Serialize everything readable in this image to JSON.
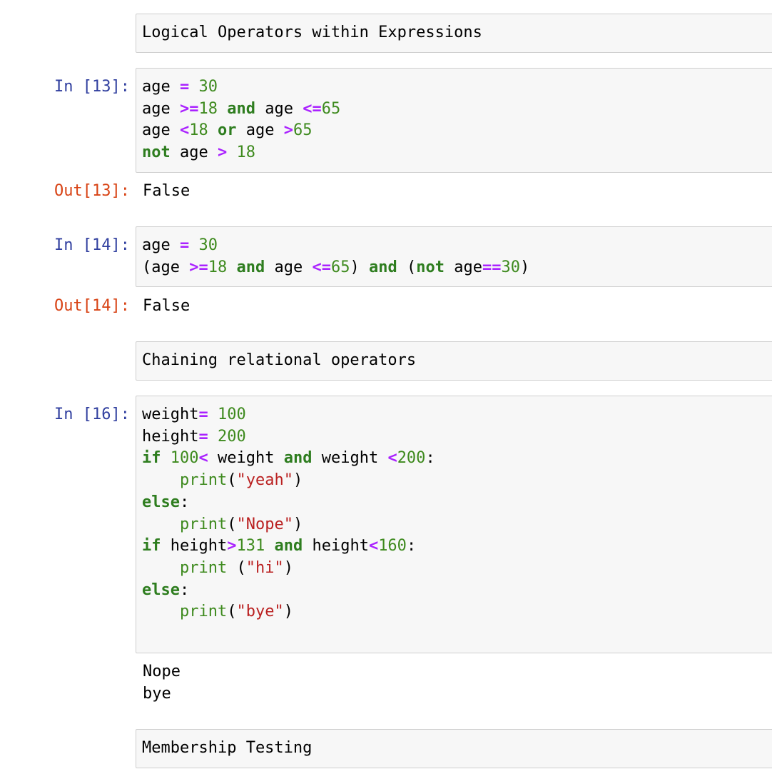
{
  "cells": {
    "md1": {
      "text": "Logical Operators within Expressions"
    },
    "c13": {
      "in_prompt": "In [13]:",
      "out_prompt": "Out[13]:",
      "output": "False",
      "tokens": [
        [
          [
            "t",
            "age "
          ],
          [
            "op",
            "="
          ],
          [
            "t",
            " "
          ],
          [
            "num",
            "30"
          ]
        ],
        [
          [
            "t",
            "age "
          ],
          [
            "op",
            ">="
          ],
          [
            "num",
            "18"
          ],
          [
            "t",
            " "
          ],
          [
            "kw",
            "and"
          ],
          [
            "t",
            " age "
          ],
          [
            "op",
            "<="
          ],
          [
            "num",
            "65"
          ]
        ],
        [
          [
            "t",
            "age "
          ],
          [
            "op",
            "<"
          ],
          [
            "num",
            "18"
          ],
          [
            "t",
            " "
          ],
          [
            "kw",
            "or"
          ],
          [
            "t",
            " age "
          ],
          [
            "op",
            ">"
          ],
          [
            "num",
            "65"
          ]
        ],
        [
          [
            "kw",
            "not"
          ],
          [
            "t",
            " age "
          ],
          [
            "op",
            ">"
          ],
          [
            "t",
            " "
          ],
          [
            "num",
            "18"
          ]
        ]
      ]
    },
    "c14": {
      "in_prompt": "In [14]:",
      "out_prompt": "Out[14]:",
      "output": "False",
      "tokens": [
        [
          [
            "t",
            "age "
          ],
          [
            "op",
            "="
          ],
          [
            "t",
            " "
          ],
          [
            "num",
            "30"
          ]
        ],
        [
          [
            "t",
            "(age "
          ],
          [
            "op",
            ">="
          ],
          [
            "num",
            "18"
          ],
          [
            "t",
            " "
          ],
          [
            "kw",
            "and"
          ],
          [
            "t",
            " age "
          ],
          [
            "op",
            "<="
          ],
          [
            "num",
            "65"
          ],
          [
            "t",
            ") "
          ],
          [
            "kw",
            "and"
          ],
          [
            "t",
            " ("
          ],
          [
            "kw",
            "not"
          ],
          [
            "t",
            " age"
          ],
          [
            "op",
            "=="
          ],
          [
            "num",
            "30"
          ],
          [
            "t",
            ")"
          ]
        ]
      ]
    },
    "md2": {
      "text": "Chaining relational operators"
    },
    "c16": {
      "in_prompt": "In [16]:",
      "output": "Nope\nbye",
      "tokens": [
        [
          [
            "t",
            "weight"
          ],
          [
            "op",
            "="
          ],
          [
            "t",
            " "
          ],
          [
            "num",
            "100"
          ]
        ],
        [
          [
            "t",
            "height"
          ],
          [
            "op",
            "="
          ],
          [
            "t",
            " "
          ],
          [
            "num",
            "200"
          ]
        ],
        [
          [
            "kw",
            "if"
          ],
          [
            "t",
            " "
          ],
          [
            "num",
            "100"
          ],
          [
            "op",
            "<"
          ],
          [
            "t",
            " weight "
          ],
          [
            "kw",
            "and"
          ],
          [
            "t",
            " weight "
          ],
          [
            "op",
            "<"
          ],
          [
            "num",
            "200"
          ],
          [
            "t",
            ":"
          ]
        ],
        [
          [
            "t",
            "    "
          ],
          [
            "bi",
            "print"
          ],
          [
            "t",
            "("
          ],
          [
            "str",
            "\"yeah\""
          ],
          [
            "t",
            ")"
          ]
        ],
        [
          [
            "kw",
            "else"
          ],
          [
            "t",
            ":"
          ]
        ],
        [
          [
            "t",
            "    "
          ],
          [
            "bi",
            "print"
          ],
          [
            "t",
            "("
          ],
          [
            "str",
            "\"Nope\""
          ],
          [
            "t",
            ")"
          ]
        ],
        [
          [
            "kw",
            "if"
          ],
          [
            "t",
            " height"
          ],
          [
            "op",
            ">"
          ],
          [
            "num",
            "131"
          ],
          [
            "t",
            " "
          ],
          [
            "kw",
            "and"
          ],
          [
            "t",
            " height"
          ],
          [
            "op",
            "<"
          ],
          [
            "num",
            "160"
          ],
          [
            "t",
            ":"
          ]
        ],
        [
          [
            "t",
            "    "
          ],
          [
            "bi",
            "print"
          ],
          [
            "t",
            " ("
          ],
          [
            "str",
            "\"hi\""
          ],
          [
            "t",
            ")"
          ]
        ],
        [
          [
            "kw",
            "else"
          ],
          [
            "t",
            ":"
          ]
        ],
        [
          [
            "t",
            "    "
          ],
          [
            "bi",
            "print"
          ],
          [
            "t",
            "("
          ],
          [
            "str",
            "\"bye\""
          ],
          [
            "t",
            ")"
          ]
        ]
      ]
    },
    "md3": {
      "text": "Membership Testing"
    }
  },
  "colors": {
    "in_prompt": "#303f9f",
    "out_prompt": "#d84315",
    "keyword": "#2e7d1f",
    "operator": "#aa22ff",
    "number": "#3e8a1e",
    "string": "#ba2121",
    "cell_bg": "#f7f7f7",
    "cell_border": "#cfcfcf"
  }
}
